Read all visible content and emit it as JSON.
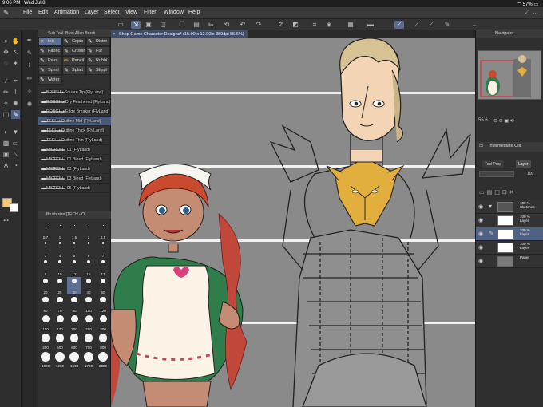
{
  "status": {
    "time": "9:06 PM",
    "date": "Wed Jul 8",
    "battery": "57%"
  },
  "menu": [
    "File",
    "Edit",
    "Animation",
    "Layer",
    "Select",
    "View",
    "Filter",
    "Window",
    "Help"
  ],
  "brush_panel": {
    "header": "Sub Tool [Bran Allen Brush",
    "tabs": [
      {
        "label": "Ink",
        "icon": "ink-icon",
        "selected": true
      },
      {
        "label": "Copic",
        "icon": "copic-icon"
      },
      {
        "label": "Distre",
        "icon": "distress-icon"
      },
      {
        "label": "Fabric",
        "icon": "fabric-icon"
      },
      {
        "label": "Crossh",
        "icon": "crosshatch-icon"
      },
      {
        "label": "Fur",
        "icon": "fur-icon"
      },
      {
        "label": "Paint",
        "icon": "paint-icon"
      },
      {
        "label": "Pencil",
        "icon": "pencil-icon"
      },
      {
        "label": "Rubbi",
        "icon": "rubbing-icon"
      },
      {
        "label": "Speci",
        "icon": "special-icon"
      },
      {
        "label": "Splatt",
        "icon": "splatter-icon"
      },
      {
        "label": "Stippl",
        "icon": "stipple-icon"
      },
      {
        "label": "Water",
        "icon": "water-icon"
      }
    ],
    "brushes": [
      {
        "name": "BRUSH • Square Tip (FlyLand)"
      },
      {
        "name": "ROUGH • Dry Feathered (FlyLand)"
      },
      {
        "name": "ROUGH • Edge Breaker (FlyLand)"
      },
      {
        "name": "TECH • Outline Mid (FlyLand)",
        "selected": true
      },
      {
        "name": "TECH • Outline Thick (FlyLand)"
      },
      {
        "name": "TECH • Outline Thin (FlyLand)"
      },
      {
        "name": "MICRON • 01 (FlyLand)"
      },
      {
        "name": "MICRON • 01 Bleed (FlyLand)"
      },
      {
        "name": "MICRON • 03 (FlyLand)"
      },
      {
        "name": "MICRON • 03 Bleed (FlyLand)"
      },
      {
        "name": "MICRON • 05 (FlyLand)"
      }
    ],
    "size_header": "Brush size [TECH - O",
    "sizes": [
      "0.7",
      "1",
      "1.5",
      "2",
      "2.5",
      "3",
      "4",
      "5",
      "6",
      "7",
      "8",
      "10",
      "12",
      "15",
      "17",
      "20",
      "25",
      "30",
      "40",
      "50",
      "60",
      "70",
      "80",
      "100",
      "120",
      "150",
      "170",
      "200",
      "250",
      "300",
      "400",
      "500",
      "600",
      "700",
      "800",
      "1000",
      "1200",
      "1500",
      "1700",
      "2000"
    ],
    "selected_size": "30"
  },
  "canvas": {
    "tab_title": "Shop Game Character Designs* (15.00 x 12.00in 350dpi 55.6%)"
  },
  "navigator": {
    "title": "Navigator",
    "zoom": "55.6"
  },
  "layers": {
    "property_tab": "Intermediate Col",
    "tabs": [
      "Tool Prop",
      "Layer"
    ],
    "opacity": "100",
    "rows": [
      {
        "type": "folder",
        "opacity": "100 %",
        "name": "Sketches"
      },
      {
        "opacity": "100 %",
        "name": "Layer"
      },
      {
        "opacity": "100 %",
        "name": "Layer",
        "selected": true
      },
      {
        "opacity": "100 %",
        "name": "Layer"
      },
      {
        "opacity": "",
        "name": "Paper"
      }
    ]
  },
  "colors": {
    "fg": "#f2c879",
    "bg": "#ffffff",
    "accent": "#5e7192"
  }
}
